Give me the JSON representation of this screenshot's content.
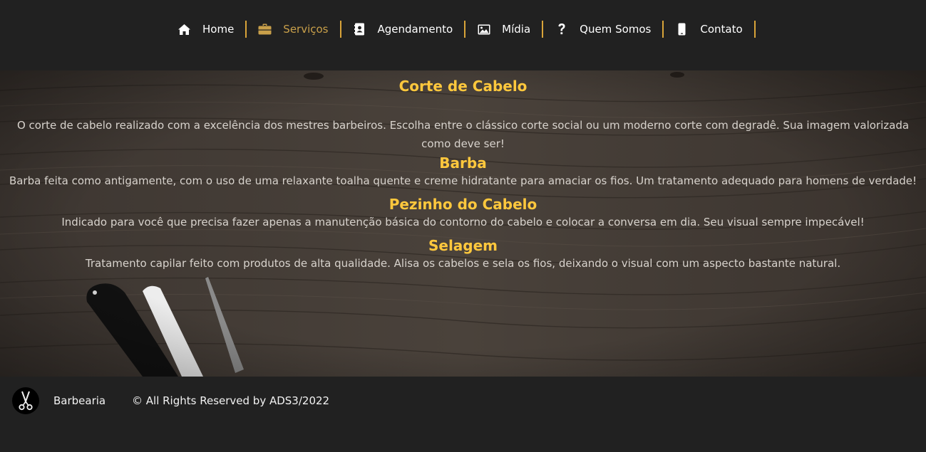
{
  "nav": {
    "items": [
      {
        "label": "Home",
        "icon": "home-icon",
        "active": false
      },
      {
        "label": "Serviços",
        "icon": "briefcase-icon",
        "active": true
      },
      {
        "label": "Agendamento",
        "icon": "address-book-icon",
        "active": false
      },
      {
        "label": "Mídia",
        "icon": "image-icon",
        "active": false
      },
      {
        "label": "Quem Somos",
        "icon": "question-icon",
        "active": false
      },
      {
        "label": "Contato",
        "icon": "phone-icon",
        "active": false
      }
    ],
    "accent_color": "#d9a439",
    "active_color": "#c9a04a"
  },
  "services": [
    {
      "title": "Corte de Cabelo",
      "description": "O corte de cabelo realizado com a excelência dos mestres barbeiros. Escolha entre o clássico corte social ou um moderno corte com degradê. Sua imagem valorizada como deve ser!"
    },
    {
      "title": "Barba",
      "description": "Barba feita como antigamente, com o uso de uma relaxante toalha quente e creme hidratante para amaciar os fios. Um tratamento adequado para homens de verdade!"
    },
    {
      "title": "Pezinho do Cabelo",
      "description": "Indicado para você que precisa fazer apenas a manutenção básica do contorno  do cabelo e colocar a conversa em dia. Seu visual sempre impecável!"
    },
    {
      "title": "Selagem",
      "description": "Tratamento capilar feito com produtos de alta qualidade. Alisa os cabelos e sela os fios, deixando o visual com um aspecto bastante natural."
    }
  ],
  "colors": {
    "title": "#ffc83d",
    "background": "#212121"
  },
  "footer": {
    "logo_icon": "scissors-icon",
    "brand": "Barbearia",
    "copyright": "© All Rights Reserved by ADS3/2022"
  }
}
